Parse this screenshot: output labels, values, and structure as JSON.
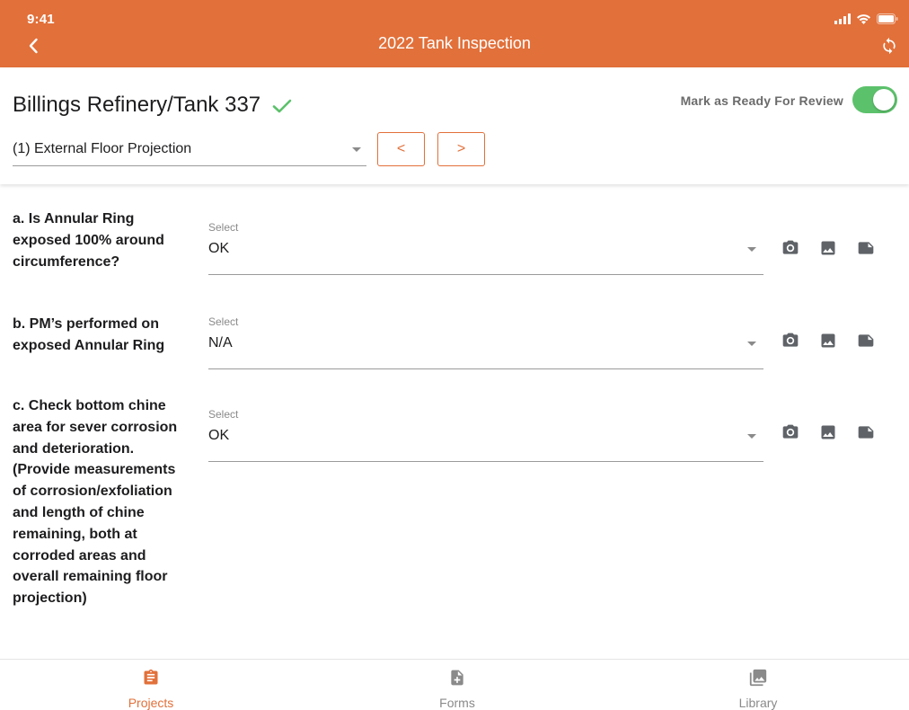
{
  "status_bar": {
    "time": "9:41"
  },
  "nav": {
    "title": "2022 Tank Inspection"
  },
  "header": {
    "site_title": "Billings Refinery/Tank 337",
    "review_label": "Mark as Ready For Review",
    "review_enabled": true,
    "section_value": "(1) External Floor Projection",
    "prev_label": "<",
    "next_label": ">"
  },
  "questions": [
    {
      "text": "a. Is Annular Ring exposed 100% around circumference?",
      "select_label": "Select",
      "value": "OK"
    },
    {
      "text": "b. PM’s performed on exposed Annular Ring",
      "select_label": "Select",
      "value": "N/A"
    },
    {
      "text": "c. Check bottom chine area for sever corrosion and deterioration. (Provide measurements of corrosion/exfoliation and length of chine remaining, both at corroded areas and overall remaining floor projection)",
      "select_label": "Select",
      "value": "OK"
    }
  ],
  "tabs": [
    {
      "label": "Projects",
      "icon": "clipboard-icon",
      "active": true
    },
    {
      "label": "Forms",
      "icon": "add-document-icon",
      "active": false
    },
    {
      "label": "Library",
      "icon": "photo-library-icon",
      "active": false
    }
  ],
  "colors": {
    "accent": "#e2703a",
    "toggle_on": "#5cc16b",
    "check": "#5cc16b",
    "icon_gray": "#5f6368"
  }
}
